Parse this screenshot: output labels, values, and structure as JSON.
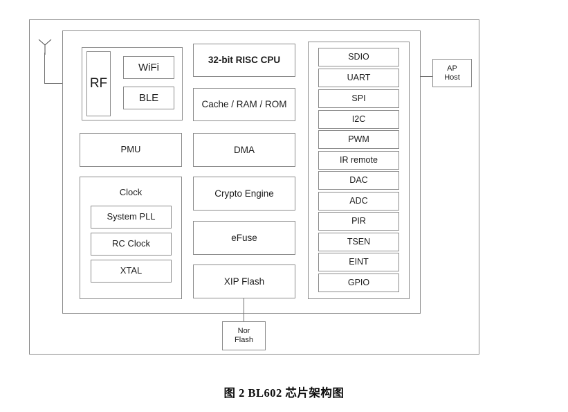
{
  "caption": "图 2 BL602 芯片架构图",
  "diagram": {
    "title": "BL602 chip architecture block diagram",
    "antenna": {
      "name": "antenna-symbol"
    },
    "rf_group": {
      "rf": "RF",
      "radios": [
        "WiFi",
        "BLE"
      ]
    },
    "left_column": {
      "pmu": "PMU",
      "clock_group": {
        "label": "Clock",
        "items": [
          "System PLL",
          "RC Clock",
          "XTAL"
        ]
      }
    },
    "middle_column": [
      "32-bit RISC CPU",
      "Cache / RAM / ROM",
      "DMA",
      "Crypto Engine",
      "eFuse",
      "XIP Flash"
    ],
    "peripherals": [
      "SDIO",
      "UART",
      "SPI",
      "I2C",
      "PWM",
      "IR remote",
      "DAC",
      "ADC",
      "PIR",
      "TSEN",
      "EINT",
      "GPIO"
    ],
    "external": {
      "ap_host_line1": "AP",
      "ap_host_line2": "Host",
      "nor_flash_line1": "Nor",
      "nor_flash_line2": "Flash"
    }
  },
  "colors": {
    "border": "#8a8a8a",
    "line": "#6f6f6f",
    "text": "#1b1b1b",
    "background": "#ffffff"
  }
}
